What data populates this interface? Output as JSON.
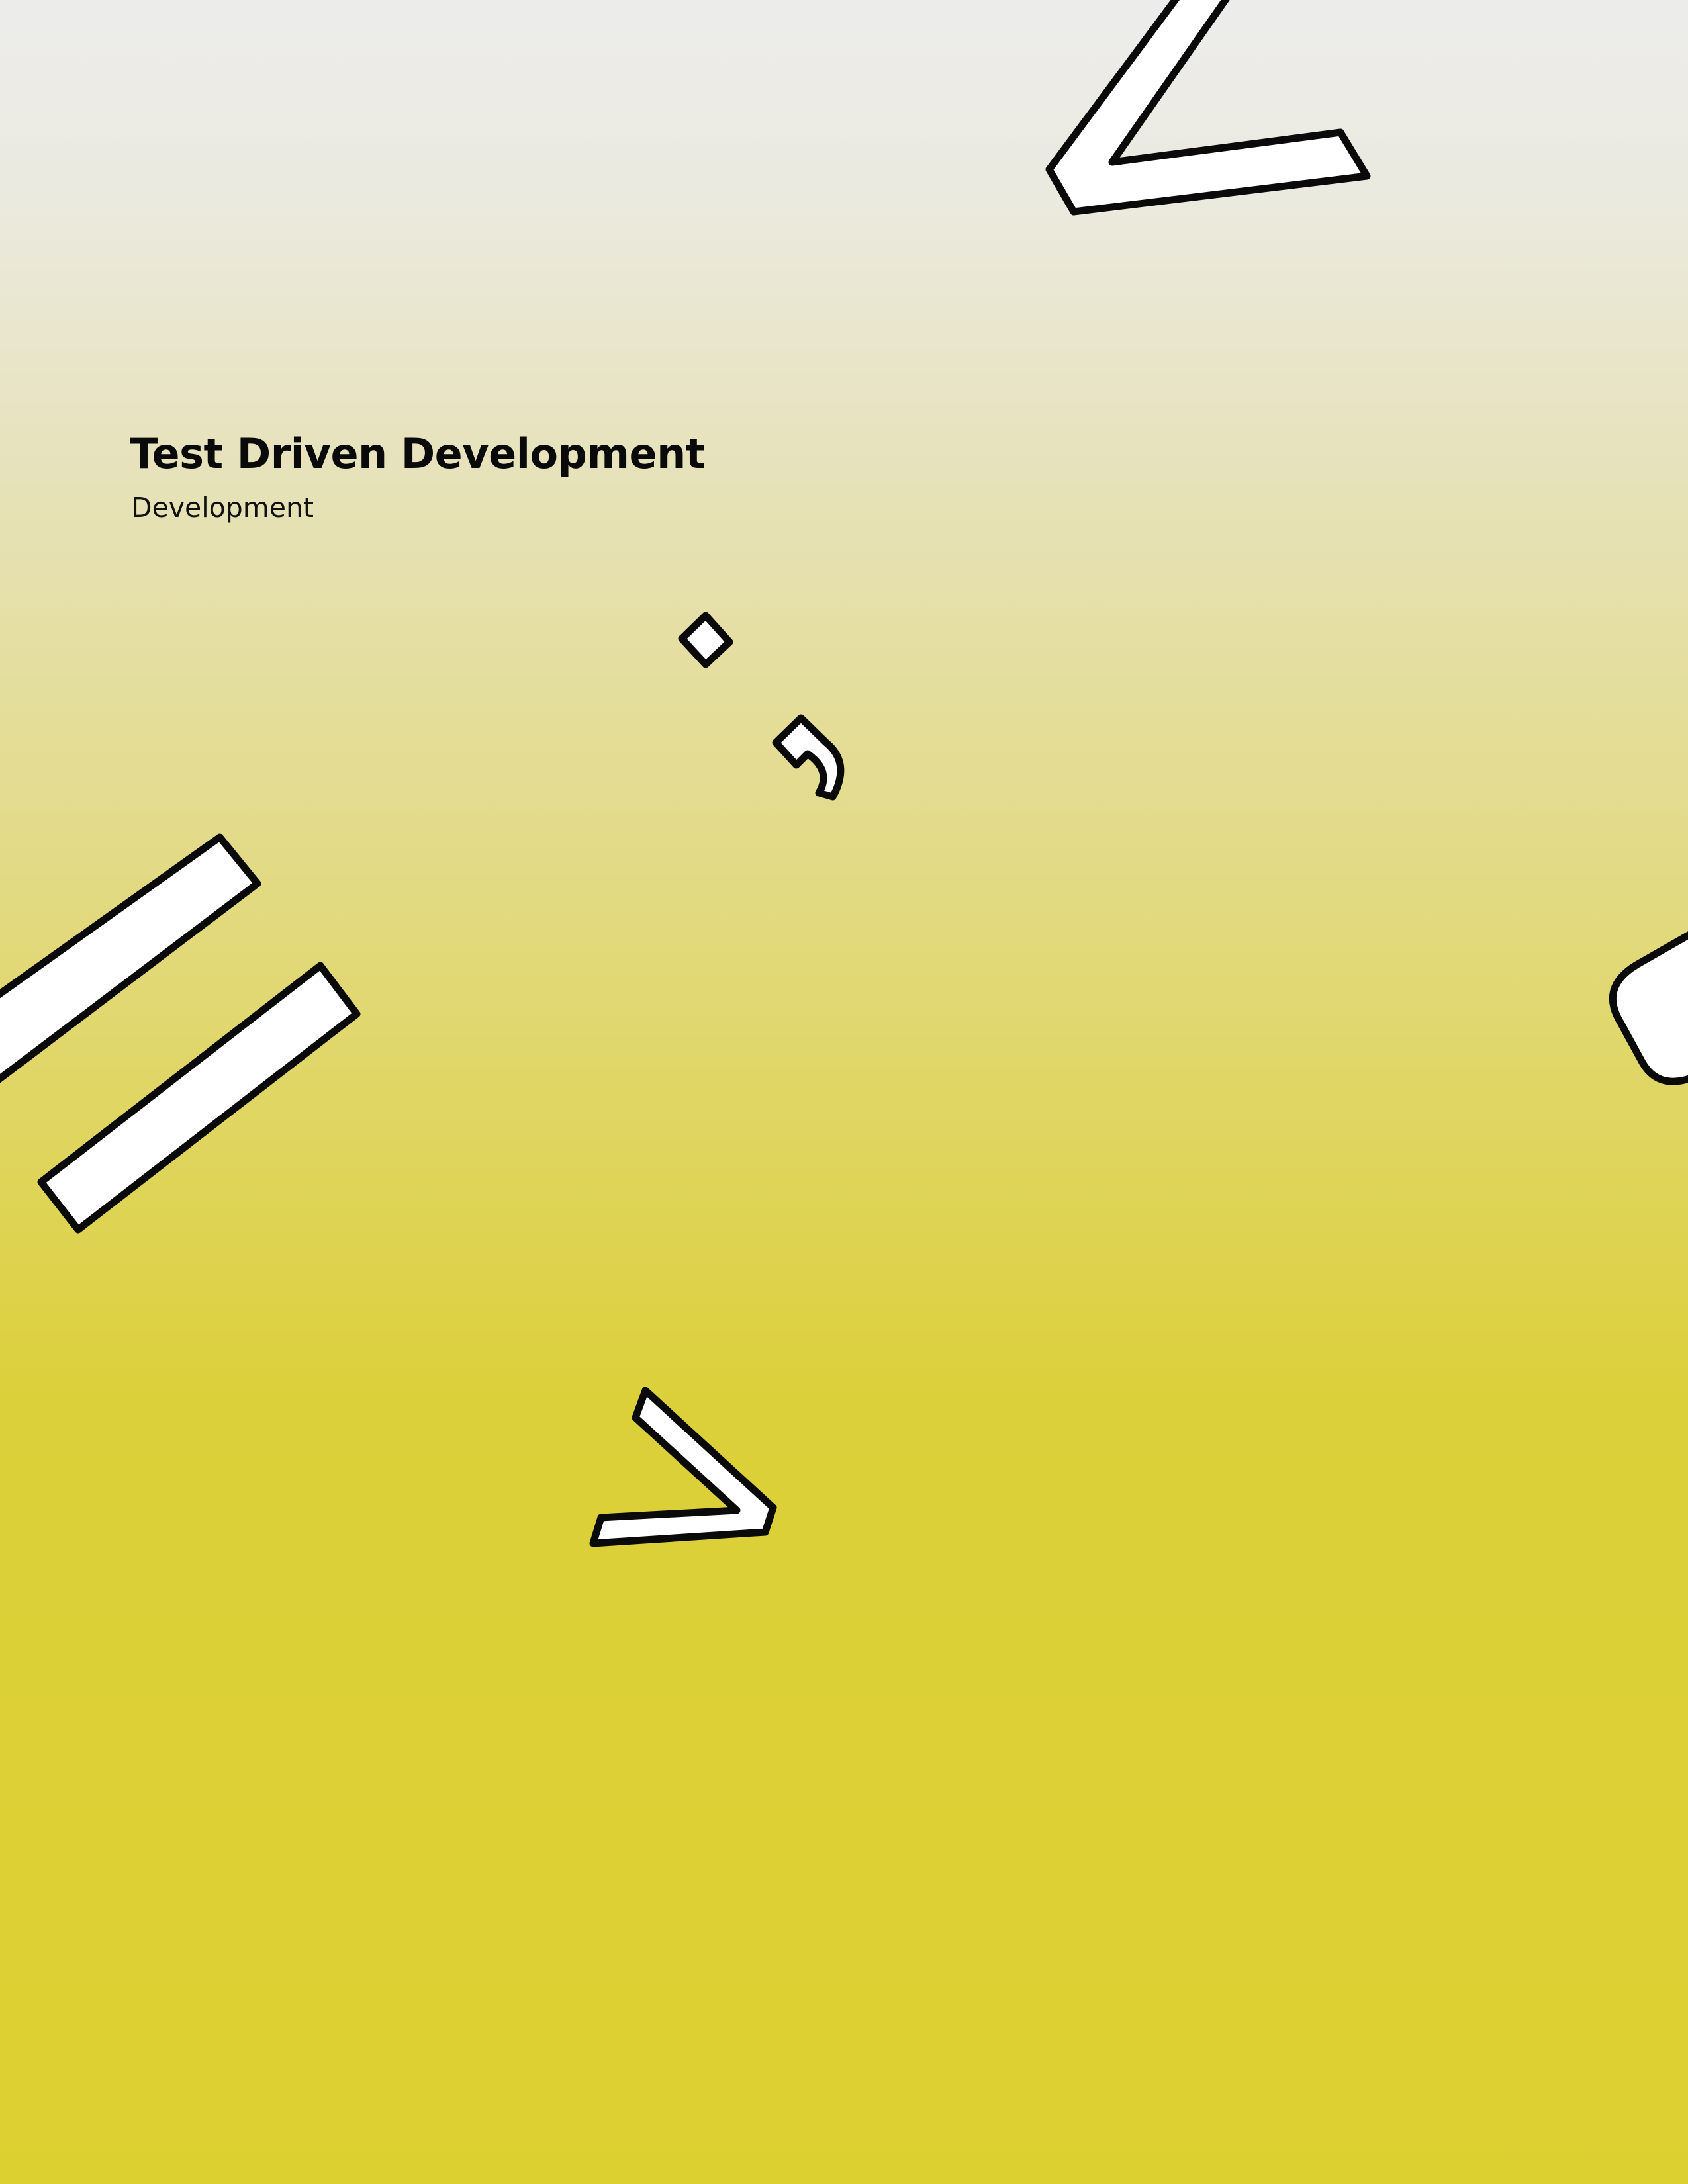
{
  "document": {
    "title": "Test Driven Development",
    "subtitle": "Development"
  },
  "colors": {
    "background_top": "#ececec",
    "background_bottom": "#dcd031",
    "shape_fill": "#ffffff",
    "shape_outline": "#0a0a0a",
    "text": "#0a0a0a"
  }
}
